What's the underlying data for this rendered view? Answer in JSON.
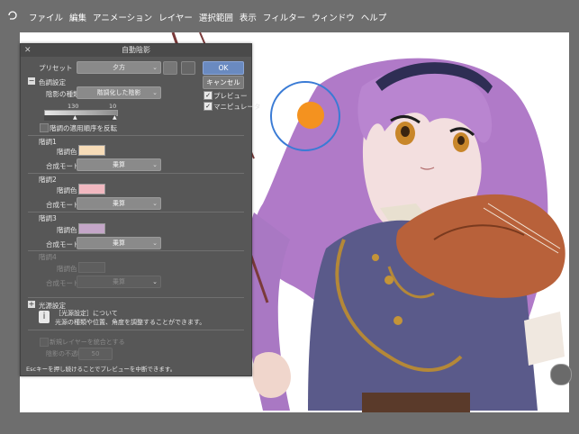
{
  "menu": [
    "ファイル",
    "編集",
    "アニメーション",
    "レイヤー",
    "選択範囲",
    "表示",
    "フィルター",
    "ウィンドウ",
    "ヘルプ"
  ],
  "dialog": {
    "title": "自動陰影",
    "preset_label": "プリセット",
    "preset_value": "夕方",
    "ok": "OK",
    "cancel": "キャンセル",
    "preview": "プレビュー",
    "manipulator": "マニピュレータ",
    "color_settings": "色調設定",
    "shadow_type_label": "陰影の種類",
    "shadow_type_value": "階調化した陰影",
    "slider_left": "130",
    "slider_right": "10",
    "reverse_order": "階調の適用順序を反転",
    "g1": "階調1",
    "g2": "階調2",
    "g3": "階調3",
    "g4": "階調4",
    "gradient_color_label": "階調色",
    "blend_mode_label": "合成モード",
    "blend_value": "乗算",
    "light_settings": "光源設定",
    "info_title": "［光源設定］について",
    "info_text": "光源の種類や位置、角度を調整することができます。",
    "new_layer": "新規レイヤーを統合とする",
    "layer_opacity_label": "陰影の不透明度",
    "layer_opacity_value": "50",
    "footer": "Escキーを押し続けることでプレビューを中断できます。"
  },
  "colors": {
    "g1": "#f7dcb8",
    "g2": "#f1b8c0",
    "g3": "#c4a6c8",
    "accent_orange": "#f4921f",
    "accent_blue": "#3a7bd5"
  }
}
